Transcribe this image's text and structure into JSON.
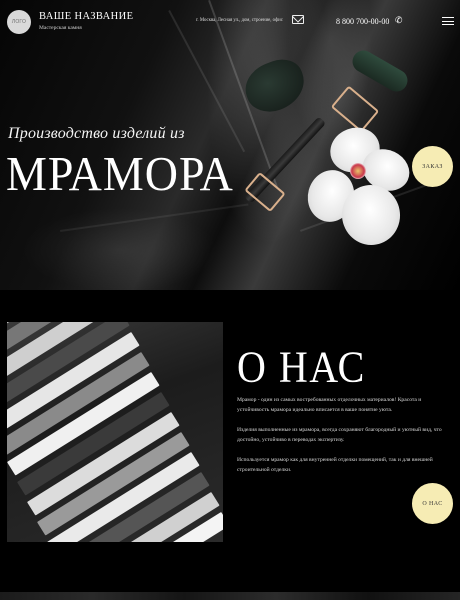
{
  "header": {
    "logo_text": "ЛОГО",
    "brand_name": "ВАШЕ НАЗВАНИЕ",
    "brand_subtitle": "Мастерская камня",
    "address": "г. Москва, Лесная ул., дом, строение, офис",
    "phone": "8 800 700-00-00"
  },
  "hero": {
    "subtitle": "Производство изделий из",
    "title": "МРАМОРА",
    "order_button": "ЗАКАЗ"
  },
  "about": {
    "title": "О НАС",
    "paragraphs": [
      "Мрамор - один из самых востребованных отделочных материалов! Красота и устойчивость мрамора идеально вписается в ваше понятие уюта.",
      "Изделия выполненные из мрамора, всегда сохраняют благородный и уютный вид, что достойно, устойчиво в переводах экспертизу.",
      "Используется мрамор как для внутренней отделки помещений, так и для внешней строительной отделки."
    ],
    "button": "О НАС"
  },
  "colors": {
    "accent_button": "#f6ecb4",
    "background": "#000000"
  },
  "icons": {
    "mail": "mail-icon",
    "phone": "phone-icon",
    "menu": "burger-menu-icon"
  }
}
